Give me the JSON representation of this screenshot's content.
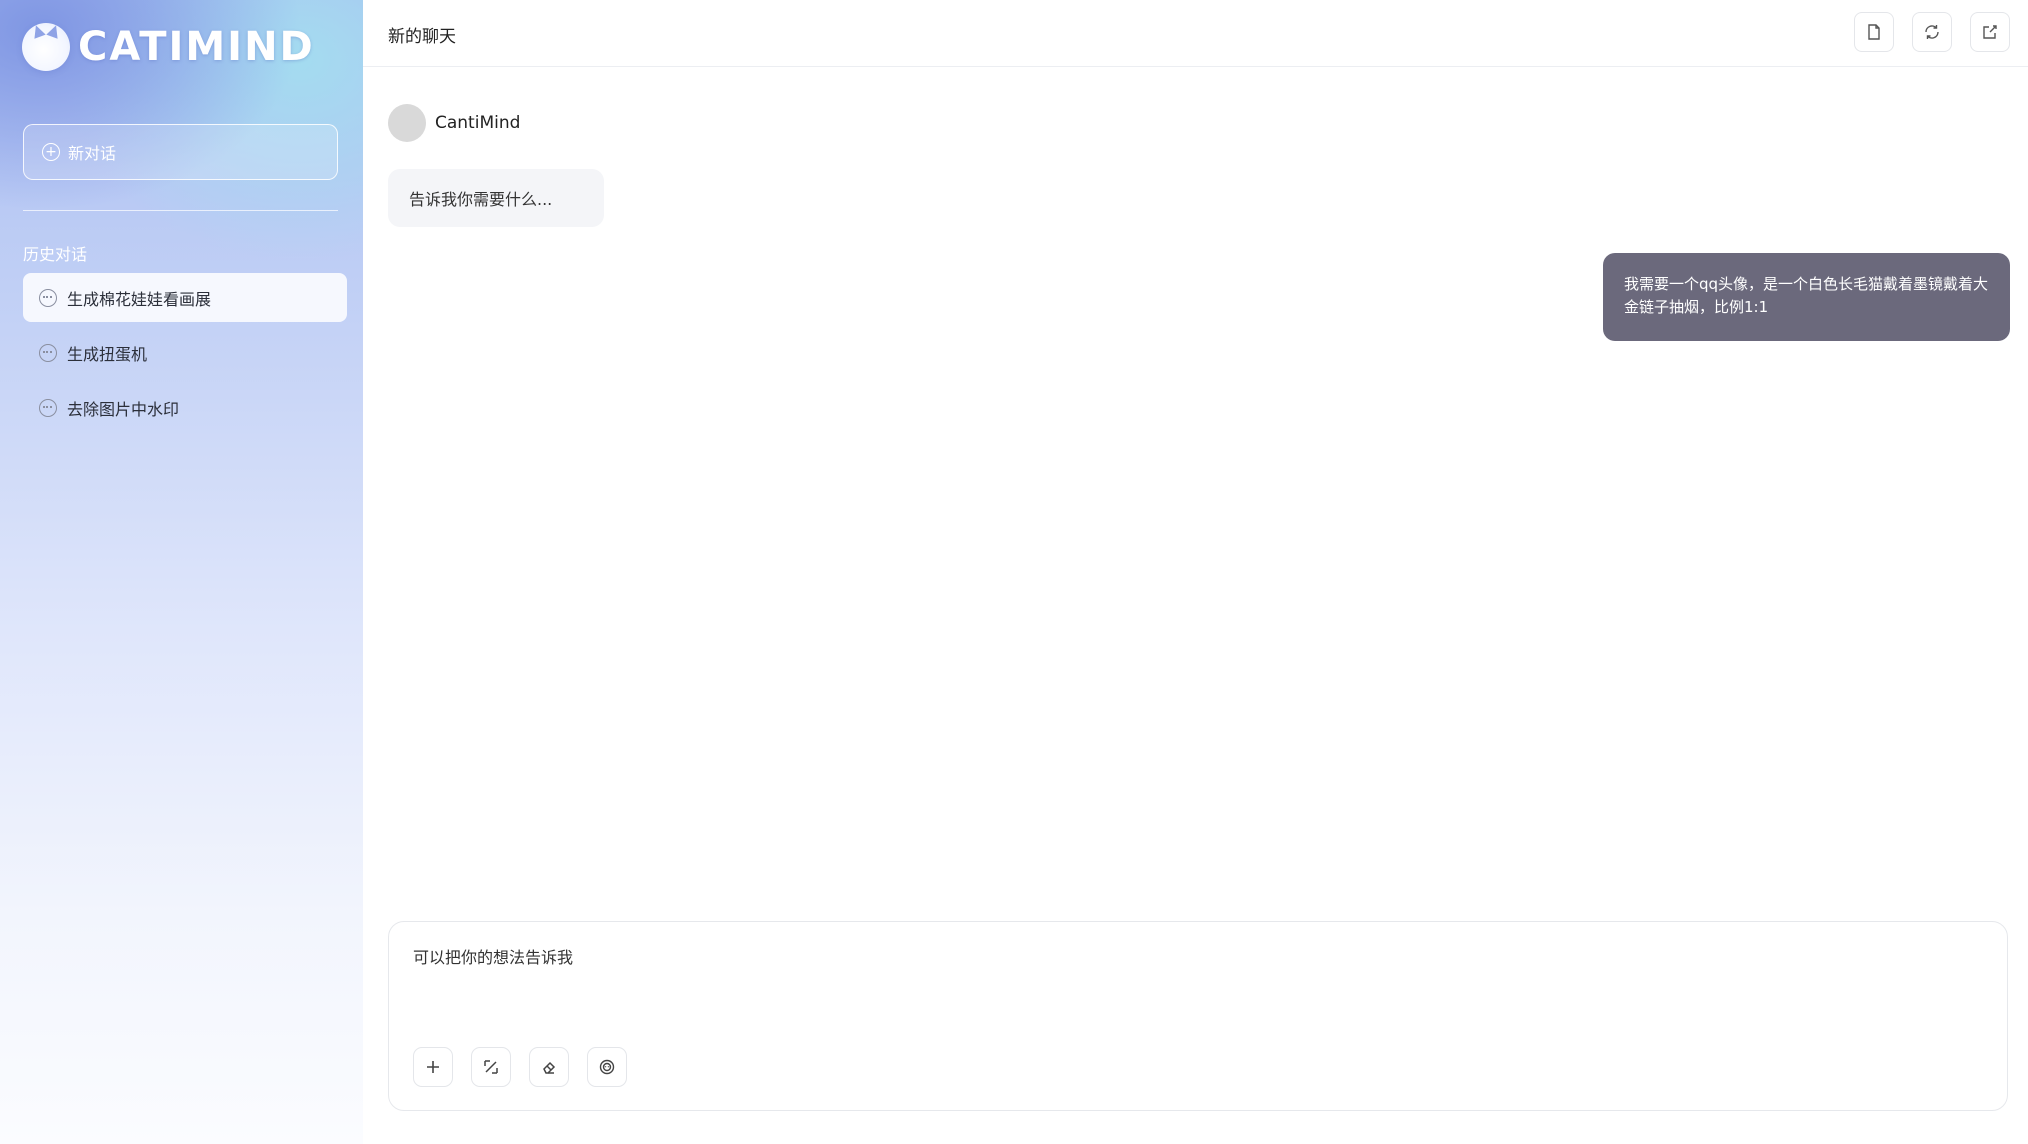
{
  "sidebar": {
    "logo_text": "CATIMIND",
    "new_chat_label": "新对话",
    "history_title": "历史对话",
    "history": [
      {
        "label": "生成棉花娃娃看画展",
        "active": true
      },
      {
        "label": "生成扭蛋机",
        "active": false
      },
      {
        "label": "去除图片中水印",
        "active": false
      }
    ]
  },
  "header": {
    "title": "新的聊天",
    "actions": [
      "document-icon",
      "refresh-icon",
      "edit-icon"
    ]
  },
  "chat": {
    "bot_name": "CantiMind",
    "bot_greeting": "告诉我你需要什么...",
    "user_message": "我需要一个qq头像，是一个白色长毛猫戴着墨镜戴着大金链子抽烟，比例1:1"
  },
  "composer": {
    "placeholder": "可以把你的想法告诉我",
    "tools": [
      "plus-icon",
      "percent-icon",
      "eraser-icon",
      "emoji-icon"
    ]
  },
  "colors": {
    "user_bubble": "#6b697c",
    "bot_bubble": "#f4f5f8",
    "sidebar_top": "#a9bdf2"
  }
}
